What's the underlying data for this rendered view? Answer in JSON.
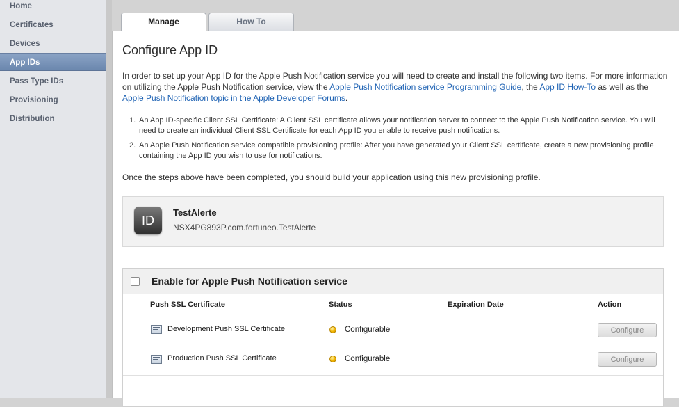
{
  "sidebar": {
    "items": [
      {
        "label": "Home"
      },
      {
        "label": "Certificates"
      },
      {
        "label": "Devices"
      },
      {
        "label": "App IDs"
      },
      {
        "label": "Pass Type IDs"
      },
      {
        "label": "Provisioning"
      },
      {
        "label": "Distribution"
      }
    ],
    "active_label": "App IDs"
  },
  "tabs": [
    {
      "label": "Manage"
    },
    {
      "label": "How To"
    }
  ],
  "page": {
    "title": "Configure App ID",
    "intro_part1": "In order to set up your App ID for the Apple Push Notification service you will need to create and install the following two items. For more information on utilizing the Apple Push Notification service, view the ",
    "intro_link1": "Apple Push Notification service Programming Guide",
    "intro_part2": ", the ",
    "intro_link2": "App ID How-To",
    "intro_part3": " as well as the ",
    "intro_link3": "Apple Push Notification topic in the Apple Developer Forums",
    "intro_part4": ".",
    "steps": [
      {
        "num": "1.",
        "text": "An App ID-specific Client SSL Certificate: A Client SSL certificate allows your notification server to connect to the Apple Push Notification service. You will need to create an individual Client SSL Certificate for each App ID you enable to receive push notifications."
      },
      {
        "num": "2.",
        "text": "An Apple Push Notification service compatible provisioning profile: After you have generated your Client SSL certificate, create a new provisioning profile containing the App ID you wish to use for notifications."
      }
    ],
    "outro": "Once the steps above have been completed, you should build your application using this new provisioning profile."
  },
  "app": {
    "icon_text": "ID",
    "name": "TestAlerte",
    "bundle_id": "NSX4PG893P.com.fortuneo.TestAlerte"
  },
  "push": {
    "enable_label": "Enable for Apple Push Notification service",
    "enabled": false,
    "columns": {
      "cert": "Push SSL Certificate",
      "status": "Status",
      "expiration": "Expiration Date",
      "action": "Action"
    },
    "rows": [
      {
        "name": "Development Push SSL Certificate",
        "status": "Configurable",
        "expiration": "",
        "action": "Configure"
      },
      {
        "name": "Production Push SSL Certificate",
        "status": "Configurable",
        "expiration": "",
        "action": "Configure"
      }
    ]
  },
  "colors": {
    "sidebar_active": "#7893b9",
    "link": "#1f63b4",
    "status_configurable": "#f2b500"
  },
  "icons": {
    "app": "app-id-icon",
    "cert": "certificate-icon",
    "status": "status-dot-icon"
  }
}
